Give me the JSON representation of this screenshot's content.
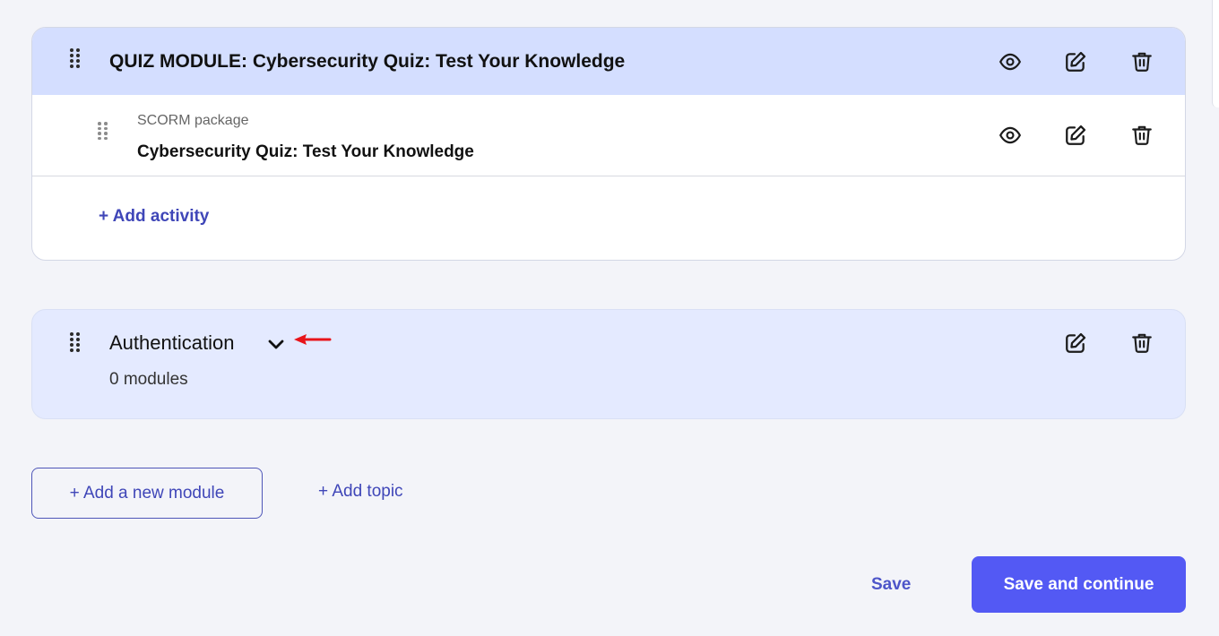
{
  "module": {
    "title": "QUIZ MODULE: Cybersecurity Quiz: Test Your Knowledge",
    "activity": {
      "type_label": "SCORM package",
      "title": "Cybersecurity Quiz: Test Your Knowledge"
    },
    "add_activity_label": "+ Add activity"
  },
  "topic": {
    "title": "Authentication",
    "count_label": "0 modules"
  },
  "actions": {
    "add_module_label": "+ Add a new module",
    "add_topic_label": "+ Add topic",
    "save_label": "Save",
    "save_continue_label": "Save and continue"
  },
  "icons": {
    "view": "eye-icon",
    "edit": "edit-icon",
    "delete": "trash-icon",
    "drag": "drag-handle-icon",
    "expand": "chevron-down-icon",
    "annotation": "red-arrow-icon"
  },
  "colors": {
    "accent": "#5359f4",
    "link": "#3f46b8",
    "module_header_bg": "#d4deff",
    "topic_bg": "#e4eaff",
    "annotation": "#e8141a"
  }
}
